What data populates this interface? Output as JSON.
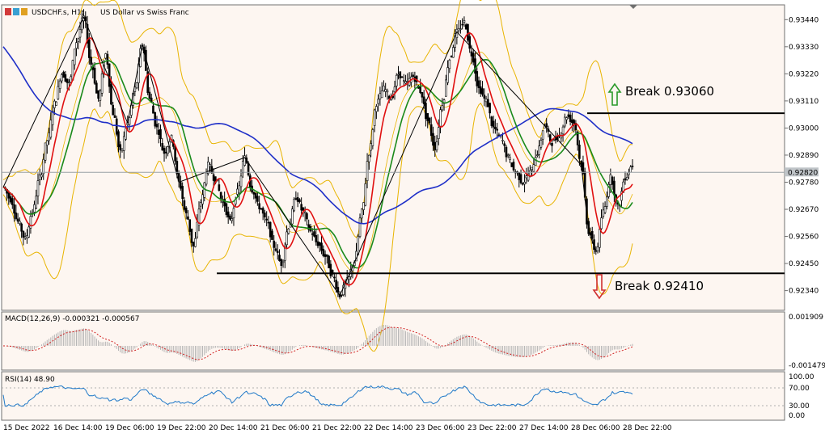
{
  "header": {
    "symbol": "USDCHF.s, H1:",
    "description": "US Dollar vs Swiss Franc"
  },
  "colors": {
    "background": "#fdf6f1",
    "grid": "#c8c8c8",
    "candle": "#000000",
    "ma_fast": "#e01010",
    "ma_mid": "#1a8a1a",
    "ma_slow": "#1f2fc8",
    "bollinger": "#e8b400",
    "zigzag": "#000000",
    "macd_hist": "#b4b4b4",
    "macd_signal": "#d02020",
    "rsi": "#1e78c8",
    "up_arrow": "#2a9a2a",
    "down_arrow": "#d03030",
    "price_tag": "#bfc4c8"
  },
  "main_panel": {
    "price_axis": [
      "0.93440",
      "0.93330",
      "0.93220",
      "0.93110",
      "0.93000",
      "0.92890",
      "0.92780",
      "0.92670",
      "0.92560",
      "0.92450",
      "0.92340"
    ],
    "current_price": "0.92820",
    "annotations": [
      {
        "label": "Break 0.93060",
        "direction": "up"
      },
      {
        "label": "Break 0.92410",
        "direction": "down"
      }
    ]
  },
  "macd_panel": {
    "title": "MACD(12,26,9) -0.000321 -0.000567",
    "axis": [
      "0.001909",
      "-0.001479"
    ]
  },
  "rsi_panel": {
    "title": "RSI(14) 48.90",
    "axis": [
      "100.00",
      "70.00",
      "30.00",
      "0.00"
    ]
  },
  "time_axis": [
    "15 Dec 2022",
    "16 Dec 14:00",
    "19 Dec 06:00",
    "19 Dec 22:00",
    "20 Dec 14:00",
    "21 Dec 06:00",
    "21 Dec 22:00",
    "22 Dec 14:00",
    "23 Dec 06:00",
    "23 Dec 22:00",
    "27 Dec 14:00",
    "28 Dec 06:00",
    "28 Dec 22:00"
  ],
  "chart_data": {
    "type": "line",
    "series": [
      {
        "values": [
          0.9276,
          0.9271,
          0.9262,
          0.9255,
          0.9266,
          0.928,
          0.9295,
          0.931,
          0.9322,
          0.9318,
          0.9335,
          0.9345,
          0.9326,
          0.9312,
          0.933,
          0.9306,
          0.929,
          0.9302,
          0.9316,
          0.9334,
          0.9312,
          0.93,
          0.929,
          0.9296,
          0.9278,
          0.9265,
          0.9252,
          0.927,
          0.9285,
          0.9279,
          0.927,
          0.9262,
          0.9274,
          0.9288,
          0.9275,
          0.9268,
          0.9262,
          0.9252,
          0.9245,
          0.926,
          0.9272,
          0.9266,
          0.9258,
          0.9253,
          0.9248,
          0.924,
          0.9232,
          0.9238,
          0.9246,
          0.9266,
          0.929,
          0.931,
          0.9316,
          0.9312,
          0.9322,
          0.9318,
          0.9321,
          0.9315,
          0.9303,
          0.9292,
          0.931,
          0.9328,
          0.9339,
          0.9343,
          0.933,
          0.9316,
          0.9311,
          0.93,
          0.9296,
          0.9288,
          0.9282,
          0.9278,
          0.9282,
          0.929,
          0.9301,
          0.9294,
          0.9297,
          0.9305,
          0.9302,
          0.9285,
          0.9258,
          0.925,
          0.9266,
          0.928,
          0.9268,
          0.928,
          0.9285
        ]
      }
    ],
    "ylim": [
      0.9226,
      0.935
    ]
  }
}
